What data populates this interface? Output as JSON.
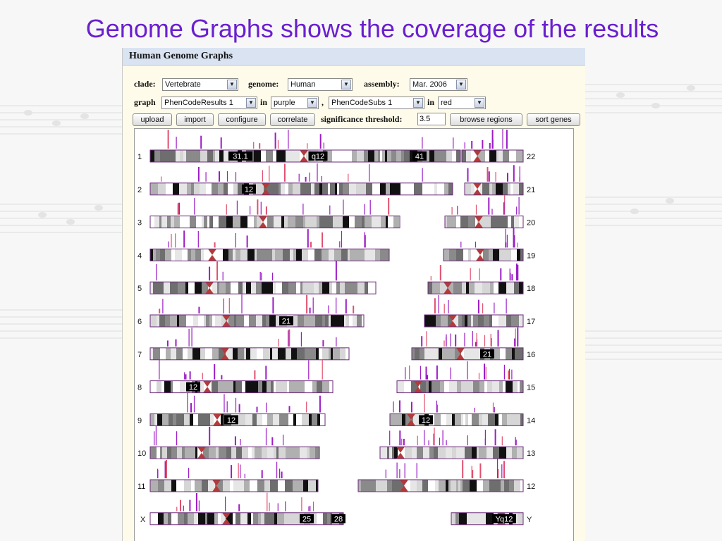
{
  "slide": {
    "title": "Genome Graphs shows the coverage of the results"
  },
  "app": {
    "window_title": "Human Genome Graphs"
  },
  "controls": {
    "clade_label": "clade:",
    "clade_value": "Vertebrate",
    "genome_label": "genome:",
    "genome_value": "Human",
    "assembly_label": "assembly:",
    "assembly_value": "Mar. 2006",
    "graph_label": "graph",
    "graph1_value": "PhenCodeResults 1",
    "in_label_1": "in",
    "color1_value": "purple",
    "comma": ",",
    "graph2_value": "PhenCodeSubs 1",
    "in_label_2": "in",
    "color2_value": "red",
    "buttons": {
      "upload": "upload",
      "import": "import",
      "configure": "configure",
      "correlate": "correlate",
      "browse_regions": "browse regions",
      "sort_genes": "sort genes"
    },
    "threshold_label": "significance threshold:",
    "threshold_value": "3.5"
  },
  "colors": {
    "title": "#6a1fd0",
    "graph1": "#9b1cc4",
    "graph2": "#e0506e",
    "centromere": "#b23a3a",
    "chrom_outline": "#6b2a7a"
  },
  "chromosomes": {
    "left": [
      {
        "name": "1",
        "band_labels": [
          "31.1",
          "q12",
          "41"
        ]
      },
      {
        "name": "2",
        "band_labels": [
          "12"
        ]
      },
      {
        "name": "3",
        "band_labels": []
      },
      {
        "name": "4",
        "band_labels": []
      },
      {
        "name": "5",
        "band_labels": []
      },
      {
        "name": "6",
        "band_labels": [
          "21"
        ]
      },
      {
        "name": "7",
        "band_labels": []
      },
      {
        "name": "8",
        "band_labels": [
          "12"
        ]
      },
      {
        "name": "9",
        "band_labels": [
          "12"
        ]
      },
      {
        "name": "10",
        "band_labels": []
      },
      {
        "name": "11",
        "band_labels": []
      },
      {
        "name": "X",
        "band_labels": [
          "25",
          "28"
        ]
      }
    ],
    "right": [
      {
        "name": "22",
        "band_labels": []
      },
      {
        "name": "21",
        "band_labels": []
      },
      {
        "name": "20",
        "band_labels": []
      },
      {
        "name": "19",
        "band_labels": []
      },
      {
        "name": "18",
        "band_labels": []
      },
      {
        "name": "17",
        "band_labels": []
      },
      {
        "name": "16",
        "band_labels": [
          "21"
        ]
      },
      {
        "name": "15",
        "band_labels": []
      },
      {
        "name": "14",
        "band_labels": [
          "12"
        ]
      },
      {
        "name": "13",
        "band_labels": []
      },
      {
        "name": "12",
        "band_labels": []
      },
      {
        "name": "Y",
        "band_labels": [
          "Yq12"
        ]
      }
    ]
  }
}
